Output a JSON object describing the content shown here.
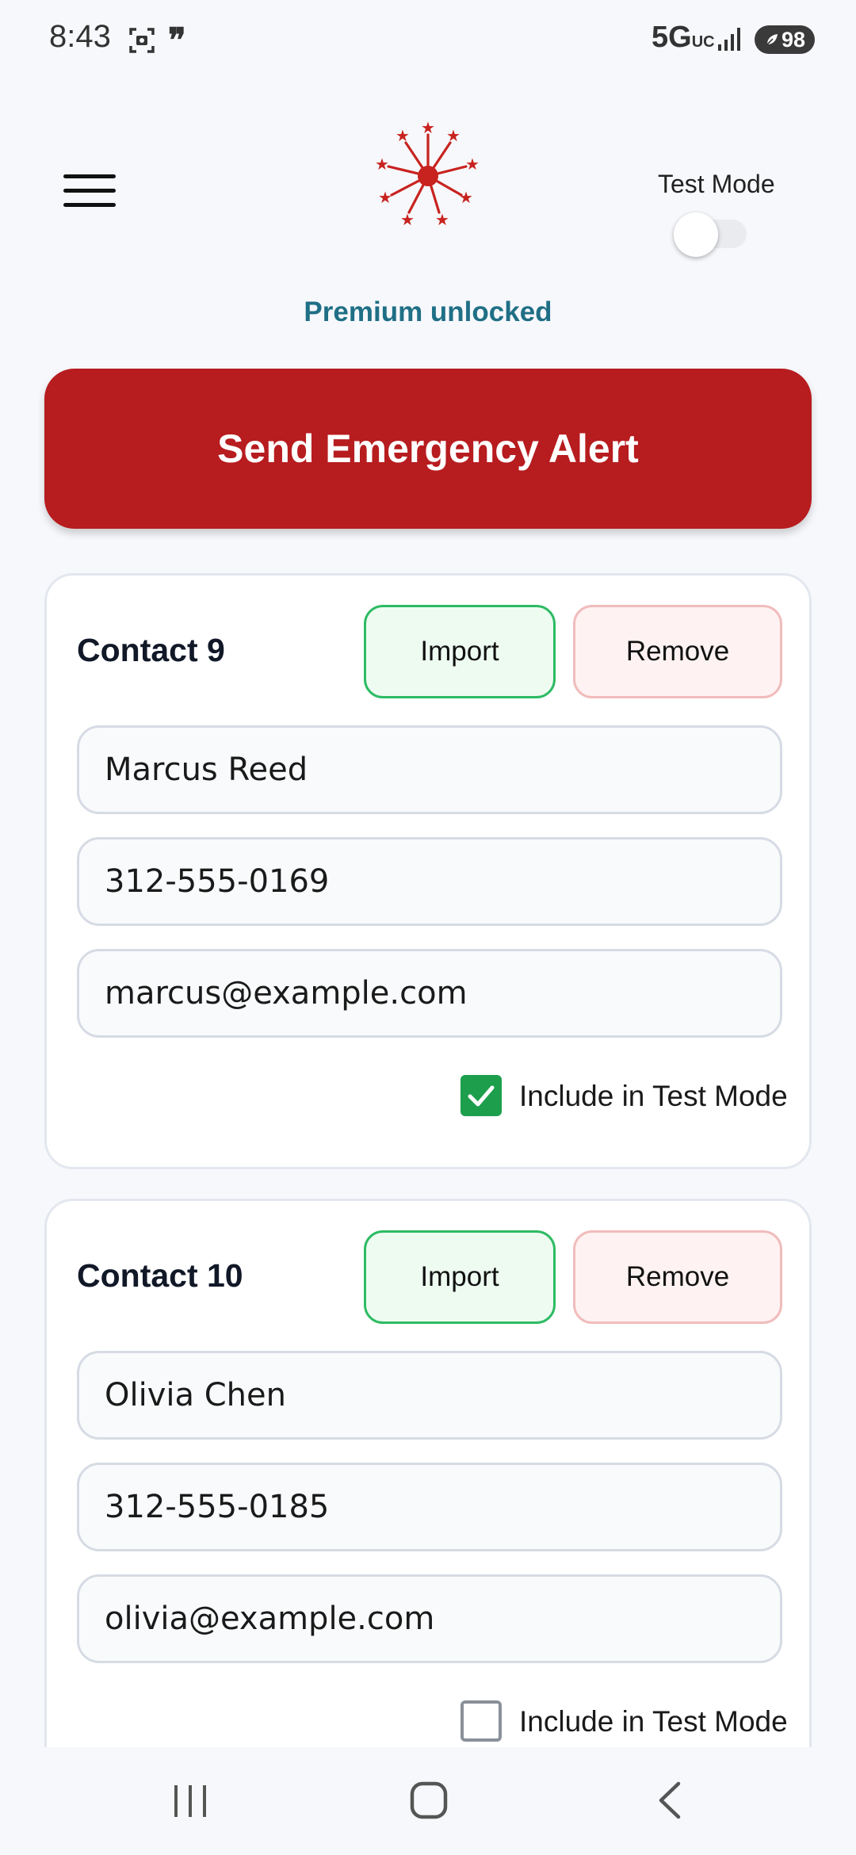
{
  "status_bar": {
    "time": "8:43",
    "network": "5G",
    "network_sub": "UC",
    "battery": "98"
  },
  "header": {
    "test_mode_label": "Test Mode",
    "test_mode_enabled": false
  },
  "premium_text": "Premium unlocked",
  "alert_button_label": "Send Emergency Alert",
  "contacts": [
    {
      "title": "Contact 9",
      "import_label": "Import",
      "remove_label": "Remove",
      "name": "Marcus Reed",
      "phone": "312-555-0169",
      "email": "marcus@example.com",
      "include_label": "Include in Test Mode",
      "include_in_test_mode": true
    },
    {
      "title": "Contact 10",
      "import_label": "Import",
      "remove_label": "Remove",
      "name": "Olivia Chen",
      "phone": "312-555-0185",
      "email": "olivia@example.com",
      "include_label": "Include in Test Mode",
      "include_in_test_mode": false
    }
  ],
  "colors": {
    "accent_red": "#b71c1f",
    "premium_teal": "#1f6f86",
    "import_green": "#2dbb63",
    "checkbox_green": "#1d9e4c"
  },
  "icons": {
    "menu": "hamburger-menu-icon",
    "logo": "starburst-logo-icon",
    "nav_recents": "recents-icon",
    "nav_home": "home-icon",
    "nav_back": "back-icon"
  }
}
